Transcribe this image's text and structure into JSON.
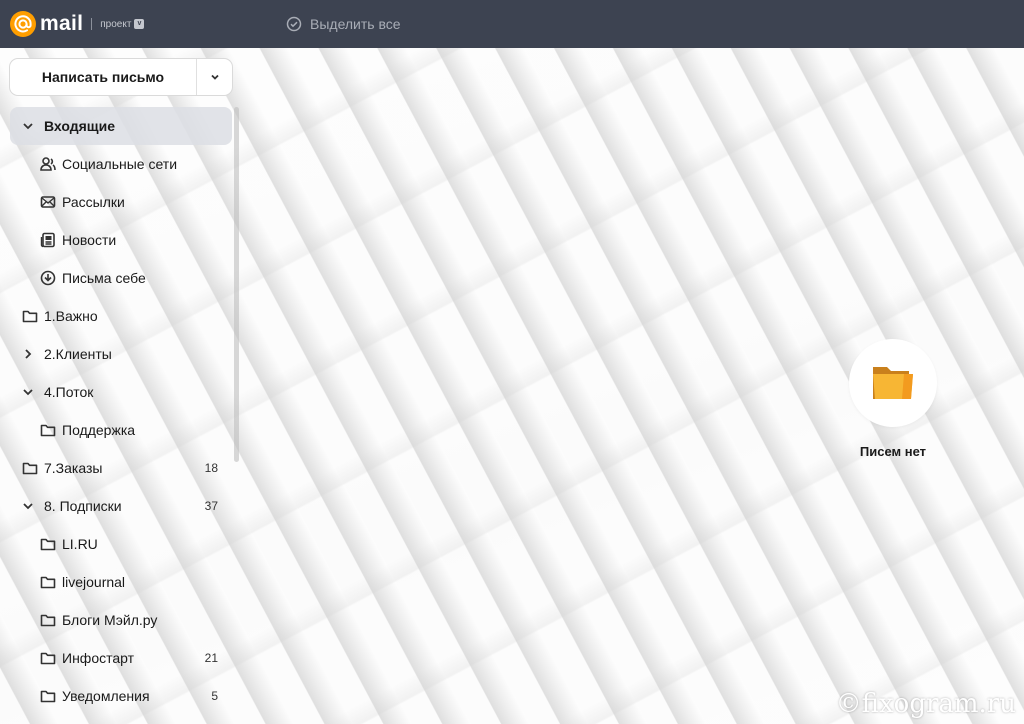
{
  "header": {
    "logo_text": "mail",
    "logo_project": "проект",
    "select_all": "Выделить все"
  },
  "compose": {
    "label": "Написать письмо"
  },
  "folders": [
    {
      "label": "Входящие",
      "count": "",
      "icon": "chevron-down"
    },
    {
      "label": "Социальные сети",
      "count": "",
      "icon": "social-icon"
    },
    {
      "label": "Рассылки",
      "count": "",
      "icon": "newsletter-icon"
    },
    {
      "label": "Новости",
      "count": "",
      "icon": "news-icon"
    },
    {
      "label": "Письма себе",
      "count": "",
      "icon": "self-mail-icon"
    },
    {
      "label": "1.Важно",
      "count": "",
      "icon": "folder-icon"
    },
    {
      "label": "2.Клиенты",
      "count": "",
      "icon": "chevron-right"
    },
    {
      "label": "4.Поток",
      "count": "",
      "icon": "chevron-down"
    },
    {
      "label": "Поддержка",
      "count": "",
      "icon": "folder-icon"
    },
    {
      "label": "7.Заказы",
      "count": "18",
      "icon": "folder-icon"
    },
    {
      "label": "8. Подписки",
      "count": "37",
      "icon": "chevron-down"
    },
    {
      "label": "LI.RU",
      "count": "",
      "icon": "folder-icon"
    },
    {
      "label": "livejournal",
      "count": "",
      "icon": "folder-icon"
    },
    {
      "label": "Блоги Мэйл.ру",
      "count": "",
      "icon": "folder-icon"
    },
    {
      "label": "Инфостарт",
      "count": "21",
      "icon": "folder-icon"
    },
    {
      "label": "Уведомления",
      "count": "5",
      "icon": "folder-icon"
    }
  ],
  "empty_state": {
    "text": "Писем нет"
  },
  "watermark": "©fixogram.ru",
  "colors": {
    "topbar": "#3d4351",
    "brand": "#ff9e00",
    "folder_illustration": "#f7b634"
  }
}
